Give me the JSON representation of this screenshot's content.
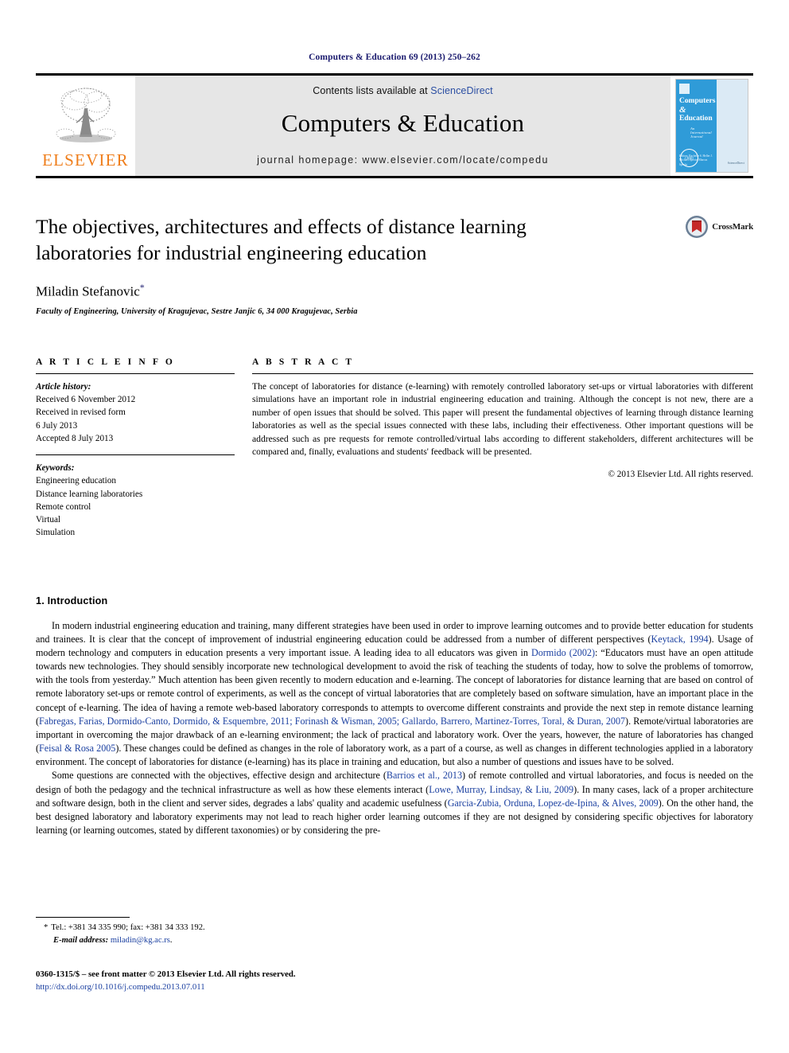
{
  "running_head": "Computers & Education 69 (2013) 250–262",
  "masthead": {
    "publisher_name": "ELSEVIER",
    "contents_prefix": "Contents lists available at ",
    "contents_link": "ScienceDirect",
    "journal_title": "Computers & Education",
    "homepage_line": "journal homepage: www.elsevier.com/locate/compedu",
    "cover": {
      "title_line1": "Computers",
      "amp": "&",
      "title_line2": "Education",
      "subtitle": "An International Journal",
      "editors": "Editors:\nRachelle S. Heller\nJ. Michael Spector\nMarcus Specht",
      "seal": "CITED",
      "publisher_small": "ScienceDirect"
    }
  },
  "article": {
    "title": "The objectives, architectures and effects of distance learning laboratories for industrial engineering education",
    "author": "Miladin Stefanovic",
    "author_marker": "*",
    "affiliation": "Faculty of Engineering, University of Kragujevac, Sestre Janjic 6, 34 000 Kragujevac, Serbia",
    "crossmark_label": "CrossMark"
  },
  "article_info": {
    "heading": "A R T I C L E   I N F O",
    "history_label": "Article history:",
    "history": [
      "Received 6 November 2012",
      "Received in revised form",
      "6 July 2013",
      "Accepted 8 July 2013"
    ],
    "keywords_label": "Keywords:",
    "keywords": [
      "Engineering education",
      "Distance learning laboratories",
      "Remote control",
      "Virtual",
      "Simulation"
    ]
  },
  "abstract": {
    "heading": "A B S T R A C T",
    "text": "The concept of laboratories for distance (e-learning) with remotely controlled laboratory set-ups or virtual laboratories with different simulations have an important role in industrial engineering education and training. Although the concept is not new, there are a number of open issues that should be solved. This paper will present the fundamental objectives of learning through distance learning laboratories as well as the special issues connected with these labs, including their effectiveness. Other important questions will be addressed such as pre requests for remote controlled/virtual labs according to different stakeholders, different architectures will be compared and, finally, evaluations and students' feedback will be presented.",
    "copyright": "© 2013 Elsevier Ltd. All rights reserved."
  },
  "body": {
    "section_title": "1. Introduction",
    "paragraph1_part1": "In modern industrial engineering education and training, many different strategies have been used in order to improve learning outcomes and to provide better education for students and trainees. It is clear that the concept of improvement of industrial engineering education could be addressed from a number of different perspectives (",
    "cite1": "Keytack, 1994",
    "paragraph1_part2": "). Usage of modern technology and computers in education presents a very important issue. A leading idea to all educators was given in ",
    "cite2": "Dormido (2002)",
    "paragraph1_part3": ": “Educators must have an open attitude towards new technologies. They should sensibly incorporate new technological development to avoid the risk of teaching the students of today, how to solve the problems of tomorrow, with the tools from yesterday.” Much attention has been given recently to modern education and e-learning. The concept of laboratories for distance learning that are based on control of remote laboratory set-ups or remote control of experiments, as well as the concept of virtual laboratories that are completely based on software simulation, have an important place in the concept of e-learning. The idea of having a remote web-based laboratory corresponds to attempts to overcome different constraints and provide the next step in remote distance learning (",
    "cite3": "Fabregas, Farias, Dormido-Canto, Dormido, & Esquembre, 2011; Forinash & Wisman, 2005; Gallardo, Barrero, Martinez-Torres, Toral, & Duran, 2007",
    "paragraph1_part4": "). Remote/virtual laboratories are important in overcoming the major drawback of an e-learning environment; the lack of practical and laboratory work. Over the years, however, the nature of laboratories has changed (",
    "cite4": "Feisal & Rosa 2005",
    "paragraph1_part5": "). These changes could be defined as changes in the role of laboratory work, as a part of a course, as well as changes in different technologies applied in a laboratory environment. The concept of laboratories for distance (e-learning) has its place in training and education, but also a number of questions and issues have to be solved.",
    "paragraph2_part1": "Some questions are connected with the objectives, effective design and architecture (",
    "cite5": "Barrios et al., 2013",
    "paragraph2_part2": ") of remote controlled and virtual laboratories, and focus is needed on the design of both the pedagogy and the technical infrastructure as well as how these elements interact (",
    "cite6": "Lowe, Murray, Lindsay, & Liu, 2009",
    "paragraph2_part3": "). In many cases, lack of a proper architecture and software design, both in the client and server sides, degrades a labs' quality and academic usefulness (",
    "cite7": "Garcia-Zubia, Orduna, Lopez-de-Ipina, & Alves, 2009",
    "paragraph2_part4": "). On the other hand, the best designed laboratory and laboratory experiments may not lead to reach higher order learning outcomes if they are not designed by considering specific objectives for laboratory learning (or learning outcomes, stated by different taxonomies) or by considering the pre-"
  },
  "footnote": {
    "marker": "*",
    "contact": "Tel.: +381 34 335 990; fax: +381 34 333 192.",
    "email_label": "E-mail address:",
    "email": "miladin@kg.ac.rs"
  },
  "footer": {
    "issn_line": "0360-1315/$ – see front matter © 2013 Elsevier Ltd. All rights reserved.",
    "doi": "http://dx.doi.org/10.1016/j.compedu.2013.07.011"
  },
  "colors": {
    "link_blue": "#1a3fa0",
    "running_head_blue": "#1a1a6e",
    "elsevier_orange": "#ef7d1a",
    "masthead_grey": "#e6e6e6",
    "cover_blue": "#2f9bd8"
  }
}
